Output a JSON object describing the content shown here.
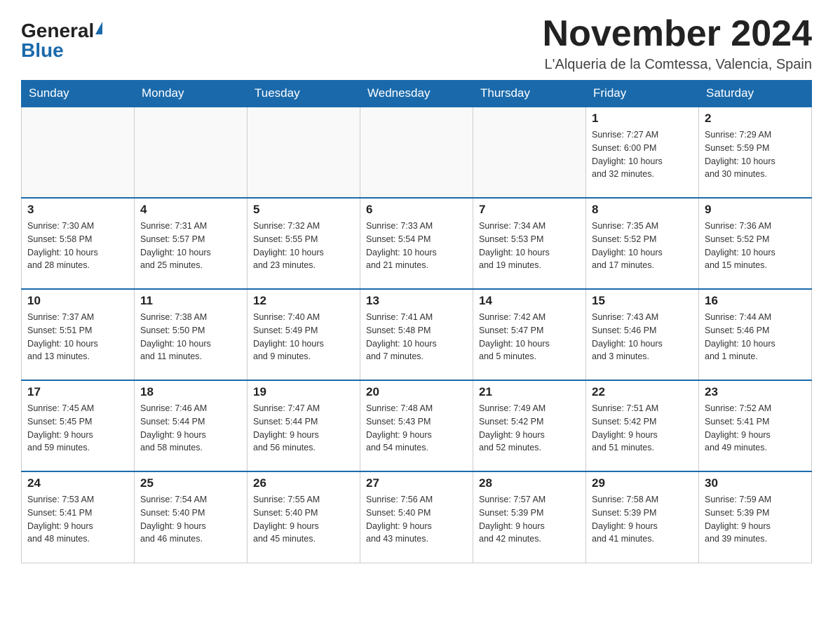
{
  "header": {
    "logo_general": "General",
    "logo_blue": "Blue",
    "month_title": "November 2024",
    "location": "L'Alqueria de la Comtessa, Valencia, Spain"
  },
  "weekdays": [
    "Sunday",
    "Monday",
    "Tuesday",
    "Wednesday",
    "Thursday",
    "Friday",
    "Saturday"
  ],
  "weeks": [
    [
      {
        "day": "",
        "info": ""
      },
      {
        "day": "",
        "info": ""
      },
      {
        "day": "",
        "info": ""
      },
      {
        "day": "",
        "info": ""
      },
      {
        "day": "",
        "info": ""
      },
      {
        "day": "1",
        "info": "Sunrise: 7:27 AM\nSunset: 6:00 PM\nDaylight: 10 hours\nand 32 minutes."
      },
      {
        "day": "2",
        "info": "Sunrise: 7:29 AM\nSunset: 5:59 PM\nDaylight: 10 hours\nand 30 minutes."
      }
    ],
    [
      {
        "day": "3",
        "info": "Sunrise: 7:30 AM\nSunset: 5:58 PM\nDaylight: 10 hours\nand 28 minutes."
      },
      {
        "day": "4",
        "info": "Sunrise: 7:31 AM\nSunset: 5:57 PM\nDaylight: 10 hours\nand 25 minutes."
      },
      {
        "day": "5",
        "info": "Sunrise: 7:32 AM\nSunset: 5:55 PM\nDaylight: 10 hours\nand 23 minutes."
      },
      {
        "day": "6",
        "info": "Sunrise: 7:33 AM\nSunset: 5:54 PM\nDaylight: 10 hours\nand 21 minutes."
      },
      {
        "day": "7",
        "info": "Sunrise: 7:34 AM\nSunset: 5:53 PM\nDaylight: 10 hours\nand 19 minutes."
      },
      {
        "day": "8",
        "info": "Sunrise: 7:35 AM\nSunset: 5:52 PM\nDaylight: 10 hours\nand 17 minutes."
      },
      {
        "day": "9",
        "info": "Sunrise: 7:36 AM\nSunset: 5:52 PM\nDaylight: 10 hours\nand 15 minutes."
      }
    ],
    [
      {
        "day": "10",
        "info": "Sunrise: 7:37 AM\nSunset: 5:51 PM\nDaylight: 10 hours\nand 13 minutes."
      },
      {
        "day": "11",
        "info": "Sunrise: 7:38 AM\nSunset: 5:50 PM\nDaylight: 10 hours\nand 11 minutes."
      },
      {
        "day": "12",
        "info": "Sunrise: 7:40 AM\nSunset: 5:49 PM\nDaylight: 10 hours\nand 9 minutes."
      },
      {
        "day": "13",
        "info": "Sunrise: 7:41 AM\nSunset: 5:48 PM\nDaylight: 10 hours\nand 7 minutes."
      },
      {
        "day": "14",
        "info": "Sunrise: 7:42 AM\nSunset: 5:47 PM\nDaylight: 10 hours\nand 5 minutes."
      },
      {
        "day": "15",
        "info": "Sunrise: 7:43 AM\nSunset: 5:46 PM\nDaylight: 10 hours\nand 3 minutes."
      },
      {
        "day": "16",
        "info": "Sunrise: 7:44 AM\nSunset: 5:46 PM\nDaylight: 10 hours\nand 1 minute."
      }
    ],
    [
      {
        "day": "17",
        "info": "Sunrise: 7:45 AM\nSunset: 5:45 PM\nDaylight: 9 hours\nand 59 minutes."
      },
      {
        "day": "18",
        "info": "Sunrise: 7:46 AM\nSunset: 5:44 PM\nDaylight: 9 hours\nand 58 minutes."
      },
      {
        "day": "19",
        "info": "Sunrise: 7:47 AM\nSunset: 5:44 PM\nDaylight: 9 hours\nand 56 minutes."
      },
      {
        "day": "20",
        "info": "Sunrise: 7:48 AM\nSunset: 5:43 PM\nDaylight: 9 hours\nand 54 minutes."
      },
      {
        "day": "21",
        "info": "Sunrise: 7:49 AM\nSunset: 5:42 PM\nDaylight: 9 hours\nand 52 minutes."
      },
      {
        "day": "22",
        "info": "Sunrise: 7:51 AM\nSunset: 5:42 PM\nDaylight: 9 hours\nand 51 minutes."
      },
      {
        "day": "23",
        "info": "Sunrise: 7:52 AM\nSunset: 5:41 PM\nDaylight: 9 hours\nand 49 minutes."
      }
    ],
    [
      {
        "day": "24",
        "info": "Sunrise: 7:53 AM\nSunset: 5:41 PM\nDaylight: 9 hours\nand 48 minutes."
      },
      {
        "day": "25",
        "info": "Sunrise: 7:54 AM\nSunset: 5:40 PM\nDaylight: 9 hours\nand 46 minutes."
      },
      {
        "day": "26",
        "info": "Sunrise: 7:55 AM\nSunset: 5:40 PM\nDaylight: 9 hours\nand 45 minutes."
      },
      {
        "day": "27",
        "info": "Sunrise: 7:56 AM\nSunset: 5:40 PM\nDaylight: 9 hours\nand 43 minutes."
      },
      {
        "day": "28",
        "info": "Sunrise: 7:57 AM\nSunset: 5:39 PM\nDaylight: 9 hours\nand 42 minutes."
      },
      {
        "day": "29",
        "info": "Sunrise: 7:58 AM\nSunset: 5:39 PM\nDaylight: 9 hours\nand 41 minutes."
      },
      {
        "day": "30",
        "info": "Sunrise: 7:59 AM\nSunset: 5:39 PM\nDaylight: 9 hours\nand 39 minutes."
      }
    ]
  ]
}
